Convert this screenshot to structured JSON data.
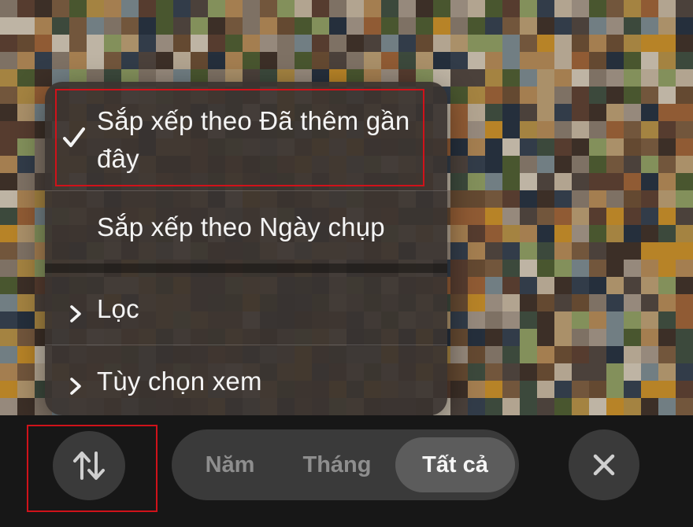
{
  "menu": {
    "items": [
      {
        "label": "Sắp xếp theo Đã thêm gần đây",
        "checked": true,
        "icon": "checkmark-icon"
      },
      {
        "label": "Sắp xếp theo Ngày chụp",
        "checked": false
      },
      {
        "label": "Lọc",
        "icon": "chevron-right-icon"
      },
      {
        "label": "Tùy chọn xem",
        "icon": "chevron-right-icon"
      }
    ]
  },
  "toolbar": {
    "sort_icon": "sort-arrows-icon",
    "segments": [
      {
        "label": "Năm",
        "selected": false
      },
      {
        "label": "Tháng",
        "selected": false
      },
      {
        "label": "Tất cả",
        "selected": true
      }
    ],
    "close_icon": "close-x-icon"
  },
  "colors": {
    "highlight": "#d0121a",
    "menu_background": "#3a3430",
    "control_background": "#3a3a3a",
    "selected_segment": "#5c5c5c"
  }
}
